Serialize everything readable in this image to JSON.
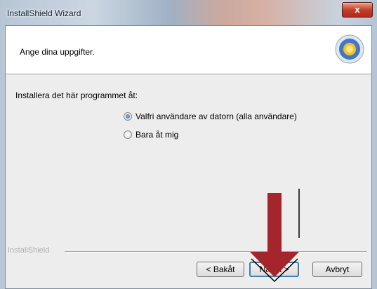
{
  "window": {
    "title": "InstallShield Wizard",
    "close_label": "x"
  },
  "header": {
    "text": "Ange dina uppgifter."
  },
  "body": {
    "prompt": "Installera det här programmet åt:",
    "options": [
      {
        "label": "Valfri användare av datorn (alla användare)",
        "selected": true
      },
      {
        "label": "Bara åt mig",
        "selected": false
      }
    ]
  },
  "footer": {
    "brand": "InstallShield"
  },
  "buttons": {
    "back": "< Bakåt",
    "next": "Nästa >",
    "cancel": "Avbryt"
  },
  "colors": {
    "arrow": "#a4262c",
    "default_button_border": "#3c7fb1"
  },
  "icons": {
    "logo": "installshield-logo-icon",
    "annotation": "down-arrow-icon"
  }
}
